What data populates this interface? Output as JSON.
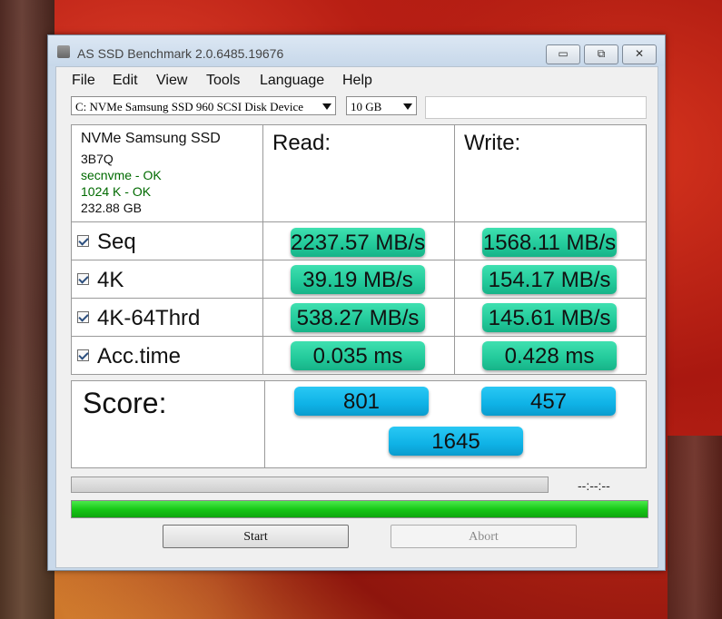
{
  "window": {
    "title": "AS SSD Benchmark 2.0.6485.19676",
    "min": "▭",
    "max": "⧉",
    "close": "✕"
  },
  "menu": [
    "File",
    "Edit",
    "View",
    "Tools",
    "Language",
    "Help"
  ],
  "drive_select": "C: NVMe Samsung SSD 960 SCSI Disk Device",
  "size_select": "10 GB",
  "info": {
    "model": "NVMe Samsung SSD",
    "firmware": "3B7Q",
    "driver": "secnvme - OK",
    "alignment": "1024 K - OK",
    "capacity": "232.88 GB"
  },
  "headers": {
    "read": "Read:",
    "write": "Write:"
  },
  "rows": [
    {
      "label": "Seq",
      "read": "2237.57 MB/s",
      "write": "1568.11 MB/s"
    },
    {
      "label": "4K",
      "read": "39.19 MB/s",
      "write": "154.17 MB/s"
    },
    {
      "label": "4K-64Thrd",
      "read": "538.27 MB/s",
      "write": "145.61 MB/s"
    },
    {
      "label": "Acc.time",
      "read": "0.035 ms",
      "write": "0.428 ms"
    }
  ],
  "score": {
    "label": "Score:",
    "read": "801",
    "write": "457",
    "total": "1645"
  },
  "timer": "--:--:--",
  "progress": {
    "test": 0,
    "overall": 1.0
  },
  "buttons": {
    "start": "Start",
    "abort": "Abort"
  },
  "colors": {
    "value_bg": "#22c99a",
    "score_bg": "#0fb2e6",
    "progress_fill": "#18c818"
  }
}
